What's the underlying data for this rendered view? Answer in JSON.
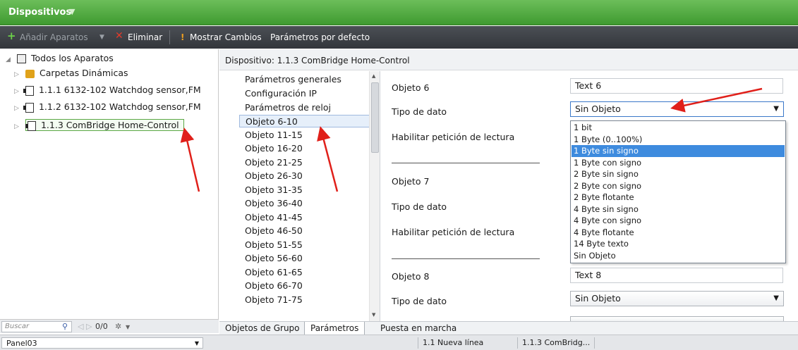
{
  "titlebar": {
    "title": "Dispositivos",
    "chevron": "▼"
  },
  "toolbar": {
    "add_label": "Añadir Aparatos",
    "delete_label": "Eliminar",
    "show_changes_label": "Mostrar Cambios",
    "defaults_label": "Parámetros por defecto"
  },
  "tree": {
    "root": "Todos los Aparatos",
    "items": [
      {
        "label": "Carpetas Dinámicas"
      },
      {
        "label": "1.1.1  6132-102 Watchdog sensor,FM"
      },
      {
        "label": "1.1.2  6132-102 Watchdog sensor,FM"
      },
      {
        "label": "1.1.3  ComBridge Home-Control"
      }
    ]
  },
  "search": {
    "placeholder": "Buscar",
    "count": "0/0"
  },
  "device_header": "Dispositivo: 1.1.3  ComBridge Home-Control",
  "param_list": [
    "Parámetros generales",
    "Configuración IP",
    "Parámetros de reloj",
    "Objeto 6-10",
    "Objeto 11-15",
    "Objeto 16-20",
    "Objeto 21-25",
    "Objeto 26-30",
    "Objeto 31-35",
    "Objeto 36-40",
    "Objeto 41-45",
    "Objeto 46-50",
    "Objeto 51-55",
    "Objeto 56-60",
    "Objeto 61-65",
    "Objeto 66-70",
    "Objeto 71-75"
  ],
  "params": {
    "obj6_label": "Objeto 6",
    "obj6_value": "Text 6",
    "tipo_label": "Tipo de dato",
    "tipo_value": "Sin Objeto",
    "lectura_label": "Habilitar petición de lectura",
    "obj7_label": "Objeto 7",
    "obj8_label": "Objeto 8",
    "obj8_value": "Text 8",
    "tipo8_value": "Sin Objeto"
  },
  "dropdown_options": [
    "1 bit",
    "1 Byte (0..100%)",
    "1 Byte sin signo",
    "1 Byte con signo",
    "2 Byte sin signo",
    "2 Byte con signo",
    "2 Byte flotante",
    "4 Byte sin signo",
    "4 Byte con signo",
    "4 Byte flotante",
    "14 Byte texto",
    "Sin Objeto"
  ],
  "dropdown_highlighted_index": 2,
  "tabs": [
    "Objetos de Grupo",
    "Parámetros",
    "Puesta en marcha"
  ],
  "statusbar": {
    "panel": "Panel03",
    "line": "1.1 Nueva línea",
    "device": "1.1.3  ComBridg..."
  },
  "colors": {
    "accent_green": "#3f9a30",
    "selection_blue": "#3e8bde",
    "annotation_red": "#e0201a"
  }
}
